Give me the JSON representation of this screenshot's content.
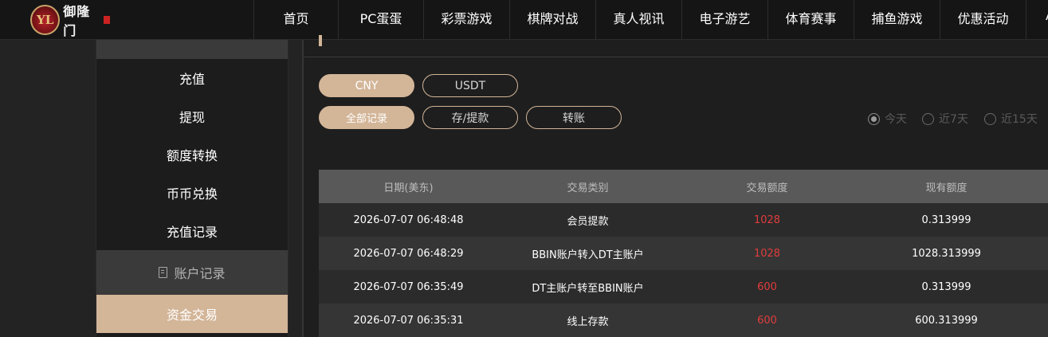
{
  "brand": {
    "logo_mark": "YL",
    "logo_text": "御隆门"
  },
  "nav": {
    "items": [
      {
        "label": "首页",
        "width": 106
      },
      {
        "label": "PC蛋蛋",
        "width": 107
      },
      {
        "label": "彩票游戏",
        "width": 108
      },
      {
        "label": "棋牌对战",
        "width": 108
      },
      {
        "label": "真人视讯",
        "width": 108
      },
      {
        "label": "电子游艺",
        "width": 108
      },
      {
        "label": "体育赛事",
        "width": 108
      },
      {
        "label": "捕鱼游戏",
        "width": 108
      },
      {
        "label": "优惠活动",
        "width": 108
      },
      {
        "label": "A",
        "width": 60
      }
    ]
  },
  "sidebar": {
    "header_ghost": "",
    "items": [
      {
        "label": "充值"
      },
      {
        "label": "提现"
      },
      {
        "label": "额度转换"
      },
      {
        "label": "币币兑换"
      },
      {
        "label": "充值记录"
      }
    ],
    "section_label": "账户记录",
    "active_item": "资金交易"
  },
  "currency_tabs": [
    {
      "label": "CNY",
      "active": true
    },
    {
      "label": "USDT",
      "active": false
    }
  ],
  "record_tabs": [
    {
      "label": "全部记录",
      "active": true
    },
    {
      "label": "存/提款",
      "active": false
    },
    {
      "label": "转账",
      "active": false
    }
  ],
  "date_filters": [
    {
      "label": "今天",
      "checked": true
    },
    {
      "label": "近7天",
      "checked": false
    },
    {
      "label": "近15天",
      "checked": false
    }
  ],
  "table": {
    "headers": [
      "日期(美东)",
      "交易类别",
      "交易额度",
      "现有额度"
    ],
    "rows": [
      {
        "date": "2026-07-07 06:48:48",
        "type": "会员提款",
        "amount": "1028",
        "balance": "0.313999"
      },
      {
        "date": "2026-07-07 06:48:29",
        "type": "BBIN账户转入DT主账户",
        "amount": "1028",
        "balance": "1028.313999"
      },
      {
        "date": "2026-07-07 06:35:49",
        "type": "DT主账户转至BBIN账户",
        "amount": "600",
        "balance": "0.313999"
      },
      {
        "date": "2026-07-07 06:35:31",
        "type": "线上存款",
        "amount": "600",
        "balance": "600.313999"
      }
    ]
  },
  "colors": {
    "accent": "#d3b598",
    "amount": "#e23c3c",
    "background": "#1e1e1e"
  }
}
